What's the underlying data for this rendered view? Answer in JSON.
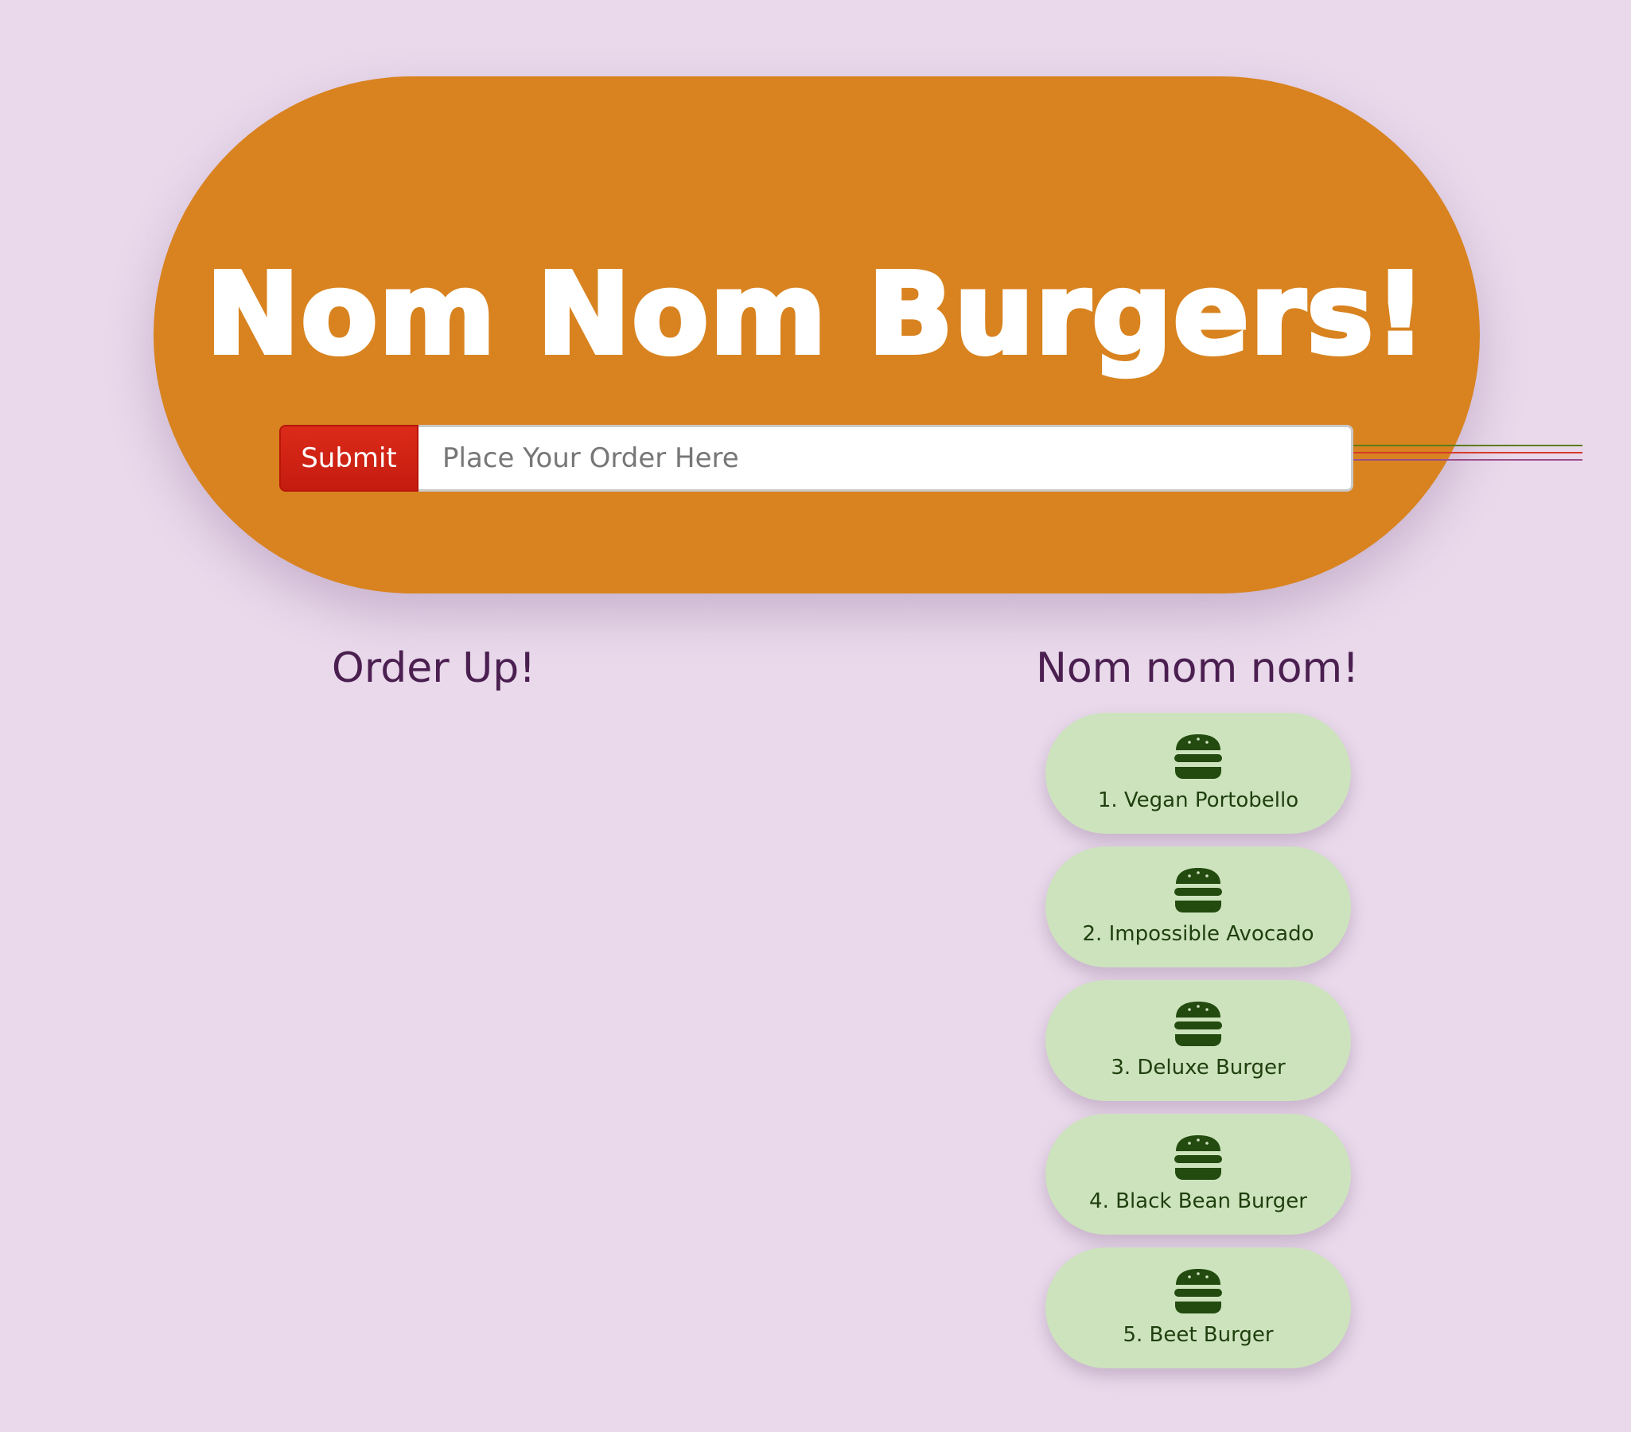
{
  "header": {
    "title": "Nom Nom Burgers!"
  },
  "order_form": {
    "submit_label": "Submit",
    "input_placeholder": "Place Your Order Here",
    "input_value": ""
  },
  "order_up": {
    "heading": "Order Up!"
  },
  "eaten": {
    "heading": "Nom nom nom!",
    "items": [
      {
        "label": "1. Vegan Portobello",
        "icon": "burger-icon"
      },
      {
        "label": "2. Impossible Avocado",
        "icon": "burger-icon"
      },
      {
        "label": "3. Deluxe Burger",
        "icon": "burger-icon"
      },
      {
        "label": "4. Black Bean Burger",
        "icon": "burger-icon"
      },
      {
        "label": "5. Beet Burger",
        "icon": "burger-icon"
      }
    ]
  },
  "colors": {
    "background": "#e9d9eb",
    "header": "#d8831f",
    "submit": "#d3241a",
    "heading_text": "#4b1f50",
    "pill": "#cde3bd",
    "pill_text": "#1f3f0e"
  }
}
